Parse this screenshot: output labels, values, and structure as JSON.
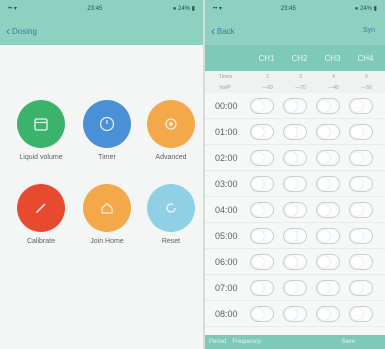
{
  "left": {
    "status": {
      "left": "•• ▾",
      "time": "23:45",
      "right": "● 24% ▮"
    },
    "nav": {
      "back_label": "Dosing"
    },
    "tiles": [
      {
        "label": "Liquid volume",
        "icon": "calendar-icon",
        "color": "#3bb36a"
      },
      {
        "label": "Timer",
        "icon": "clock-icon",
        "color": "#4a90d6"
      },
      {
        "label": "Advanced",
        "icon": "gear-icon",
        "color": "#f3a94a"
      },
      {
        "label": "Calibrate",
        "icon": "pen-icon",
        "color": "#e84a2f"
      },
      {
        "label": "Join Home",
        "icon": "home-icon",
        "color": "#f3a94a"
      },
      {
        "label": "Reset",
        "icon": "reset-icon",
        "color": "#8fd0e4"
      }
    ]
  },
  "right": {
    "status": {
      "left": "•• ▾",
      "time": "23:45",
      "right": "● 24% ▮"
    },
    "nav": {
      "back_label": "Back",
      "action_label": "Syn"
    },
    "channels": [
      "CH1",
      "CH2",
      "CH3",
      "CH4"
    ],
    "meta": [
      {
        "label": "Times",
        "values": [
          "2",
          "3",
          "4",
          "5"
        ]
      },
      {
        "label": "Vol/P",
        "values": [
          "—60",
          "—70",
          "—40",
          "—50"
        ]
      }
    ],
    "times": [
      "00:00",
      "01:00",
      "02:00",
      "03:00",
      "04:00",
      "05:00",
      "06:00",
      "07:00",
      "08:00"
    ],
    "footer": {
      "f1": "Period",
      "f2": "Frequency",
      "f3": "Save"
    }
  },
  "colors": {
    "bar": "#8fd1c1",
    "header": "#7ec9b7",
    "link": "#2f7fa8"
  }
}
